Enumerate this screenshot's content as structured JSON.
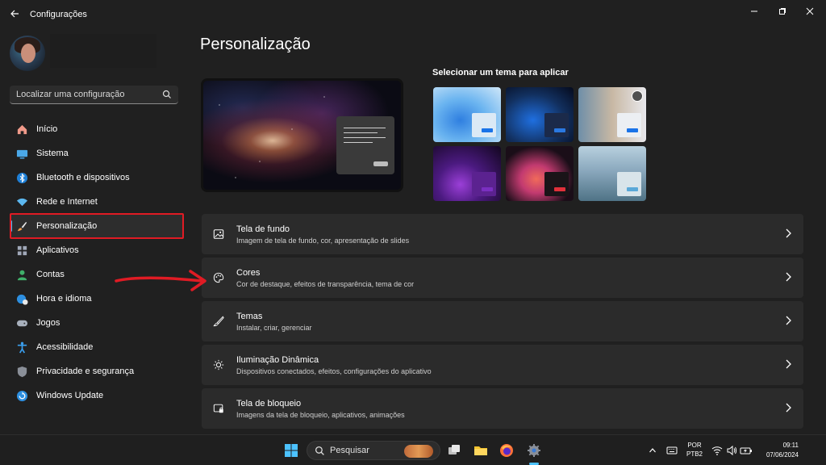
{
  "window": {
    "title": "Configurações",
    "search_placeholder": "Localizar uma configuração"
  },
  "sidebar": {
    "items": [
      {
        "label": "Início",
        "icon": "home-icon"
      },
      {
        "label": "Sistema",
        "icon": "monitor-icon"
      },
      {
        "label": "Bluetooth e dispositivos",
        "icon": "bluetooth-icon"
      },
      {
        "label": "Rede e Internet",
        "icon": "wifi-icon"
      },
      {
        "label": "Personalização",
        "icon": "paintbrush-icon",
        "active": true
      },
      {
        "label": "Aplicativos",
        "icon": "apps-icon"
      },
      {
        "label": "Contas",
        "icon": "person-icon"
      },
      {
        "label": "Hora e idioma",
        "icon": "globe-clock-icon"
      },
      {
        "label": "Jogos",
        "icon": "gamepad-icon"
      },
      {
        "label": "Acessibilidade",
        "icon": "accessibility-icon"
      },
      {
        "label": "Privacidade e segurança",
        "icon": "shield-icon"
      },
      {
        "label": "Windows Update",
        "icon": "update-icon"
      }
    ]
  },
  "main": {
    "title": "Personalização",
    "themes_label": "Selecionar um tema para aplicar",
    "settings": [
      {
        "title": "Tela de fundo",
        "desc": "Imagem de tela de fundo, cor, apresentação de slides",
        "icon": "image-icon"
      },
      {
        "title": "Cores",
        "desc": "Cor de destaque, efeitos de transparência, tema de cor",
        "icon": "palette-icon"
      },
      {
        "title": "Temas",
        "desc": "Instalar, criar, gerenciar",
        "icon": "brush-icon"
      },
      {
        "title": "Iluminação Dinâmica",
        "desc": "Dispositivos conectados, efeitos, configurações do aplicativo",
        "icon": "sun-icon"
      },
      {
        "title": "Tela de bloqueio",
        "desc": "Imagens da tela de bloqueio, aplicativos, animações",
        "icon": "lock-screen-icon"
      }
    ]
  },
  "taskbar": {
    "search_label": "Pesquisar",
    "lang_line1": "POR",
    "lang_line2": "PTB2",
    "time": "09:11",
    "date": "07/06/2024"
  },
  "colors": {
    "accent": "#4cc2ff",
    "highlight_box": "#e01b24",
    "window_bg": "#202020",
    "card_bg": "#2b2b2b"
  }
}
